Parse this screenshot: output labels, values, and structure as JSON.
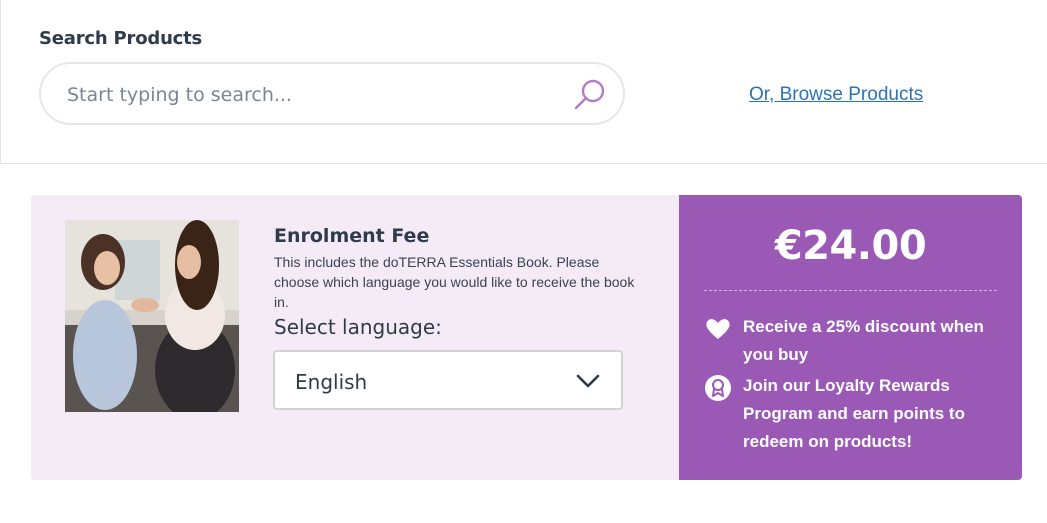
{
  "search": {
    "heading": "Search Products",
    "placeholder": "Start typing to search...",
    "value": "",
    "browse_link": "Or, Browse Products"
  },
  "product": {
    "title": "Enrolment Fee",
    "description": "This includes the doTERRA Essentials Book. Please choose which language you would like to receive the book in.",
    "language_label": "Select language:",
    "language_selected": "English",
    "price": "€24.00",
    "benefits": [
      {
        "icon": "heart-icon",
        "text": "Receive a 25% discount when you buy"
      },
      {
        "icon": "award-ribbon-icon",
        "text": "Join our Loyalty Rewards Program and earn points to redeem on products!"
      }
    ]
  },
  "colors": {
    "accent_purple": "#9b59b6",
    "card_background": "#f4ebf6",
    "link_blue": "#2a73b8",
    "search_icon": "#b57cc8"
  }
}
